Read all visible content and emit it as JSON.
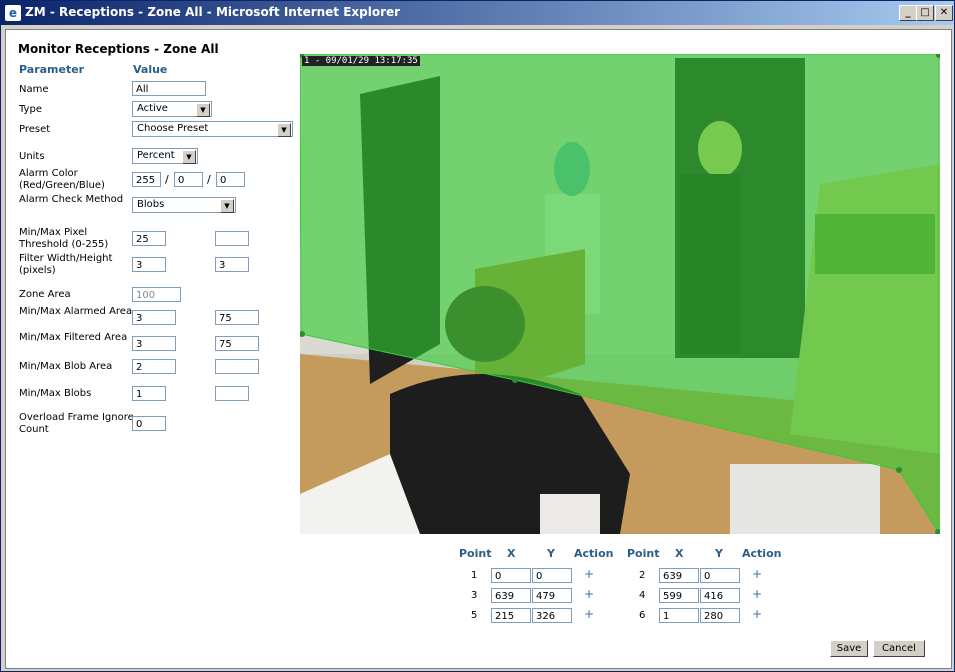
{
  "window": {
    "title": "ZM - Receptions - Zone All - Microsoft Internet Explorer"
  },
  "page": {
    "heading": "Monitor Receptions - Zone All"
  },
  "form": {
    "col_param": "Parameter",
    "col_value": "Value",
    "rows": [
      {
        "label": "Name",
        "v1": "All"
      },
      {
        "label": "Type",
        "v1": "Active"
      },
      {
        "label": "Preset",
        "v1": "Choose Preset"
      },
      {
        "label": "Units",
        "v1": "Percent"
      },
      {
        "label": "Alarm Color (Red/Green/Blue)",
        "v1": "255",
        "v2": "0",
        "v3": "0"
      },
      {
        "label": "Alarm Check Method",
        "v1": "Blobs"
      },
      {
        "label": "Min/Max Pixel Threshold (0-255)",
        "v1": "25",
        "v2": ""
      },
      {
        "label": "Filter Width/Height (pixels)",
        "v1": "3",
        "v2": "3"
      },
      {
        "label": "Zone Area",
        "v1": "100"
      },
      {
        "label": "Min/Max Alarmed Area",
        "v1": "3",
        "v2": "75"
      },
      {
        "label": "Min/Max Filtered Area",
        "v1": "3",
        "v2": "75"
      },
      {
        "label": "Min/Max Blob Area",
        "v1": "2",
        "v2": ""
      },
      {
        "label": "Min/Max Blobs",
        "v1": "1",
        "v2": ""
      },
      {
        "label": "Overload Frame Ignore Count",
        "v1": "0"
      }
    ]
  },
  "camera": {
    "timestamp": "1 - 09/01/29 13:17:35",
    "zone_color": "#33cc33"
  },
  "points": {
    "headers": [
      "Point",
      "X",
      "Y",
      "Action"
    ],
    "action_glyph": "+",
    "list": [
      {
        "n": "1",
        "x": "0",
        "y": "0"
      },
      {
        "n": "2",
        "x": "639",
        "y": "0"
      },
      {
        "n": "3",
        "x": "639",
        "y": "479"
      },
      {
        "n": "4",
        "x": "599",
        "y": "416"
      },
      {
        "n": "5",
        "x": "215",
        "y": "326"
      },
      {
        "n": "6",
        "x": "1",
        "y": "280"
      }
    ]
  },
  "buttons": {
    "save": "Save",
    "cancel": "Cancel"
  }
}
